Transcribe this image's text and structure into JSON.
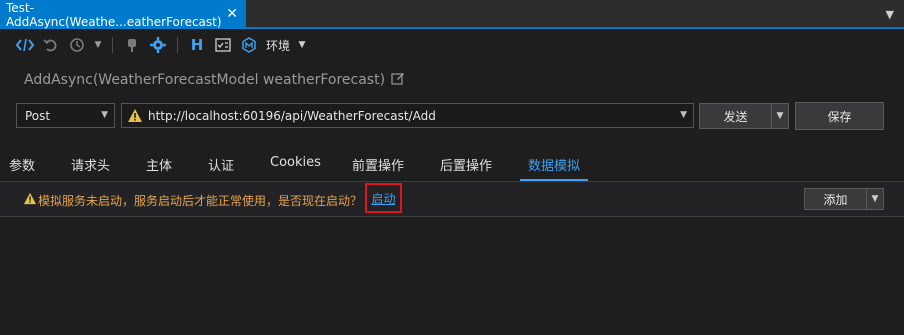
{
  "document_tab": {
    "title": "Test-AddAsync(Weathe...eatherForecast)",
    "close": "✕"
  },
  "toolbar": {
    "env_label": "环境"
  },
  "api": {
    "title": "AddAsync(WeatherForecastModel weatherForecast)"
  },
  "request": {
    "method": "Post",
    "url": "http://localhost:60196/api/WeatherForecast/Add",
    "send_label": "发送",
    "save_label": "保存"
  },
  "tabs": [
    {
      "label": "参数"
    },
    {
      "label": "请求头"
    },
    {
      "label": "主体"
    },
    {
      "label": "认证"
    },
    {
      "label": "Cookies"
    },
    {
      "label": "前置操作"
    },
    {
      "label": "后置操作"
    },
    {
      "label": "数据模拟",
      "active": true
    }
  ],
  "notice": {
    "text": "模拟服务未启动，服务启动后才能正常使用，是否现在启动？",
    "link_label": "启动"
  },
  "add_label": "添加",
  "colors": {
    "accent": "#007acc",
    "link": "#3f9ff0",
    "warning": "#e5a24a",
    "highlight": "#e0141e"
  }
}
